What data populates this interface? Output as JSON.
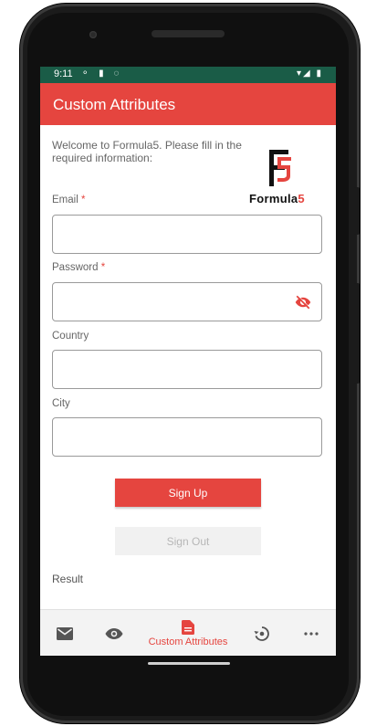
{
  "status_bar": {
    "time": "9:11",
    "left_icons": "⚬ ▮ ◌",
    "right_icons": "▾◢ ▮"
  },
  "app_bar": {
    "title": "Custom Attributes"
  },
  "welcome_text": "Welcome to Formula5. Please fill in the required information:",
  "logo": {
    "wordmark_main": "Formula",
    "wordmark_accent": "5"
  },
  "form": {
    "email": {
      "label": "Email",
      "required_mark": "*",
      "value": ""
    },
    "password": {
      "label": "Password",
      "required_mark": "*",
      "value": ""
    },
    "country": {
      "label": "Country",
      "value": ""
    },
    "city": {
      "label": "City",
      "value": ""
    }
  },
  "buttons": {
    "sign_up": "Sign Up",
    "sign_out": "Sign Out"
  },
  "result_label": "Result",
  "bottom_nav": {
    "items": [
      {
        "icon": "mail-icon"
      },
      {
        "icon": "eye-icon"
      },
      {
        "icon": "document-icon",
        "label": "Custom Attributes",
        "active": true
      },
      {
        "icon": "restore-icon"
      },
      {
        "icon": "more-icon"
      }
    ]
  },
  "colors": {
    "accent": "#e5453f",
    "status_bar": "#1a5c47"
  }
}
